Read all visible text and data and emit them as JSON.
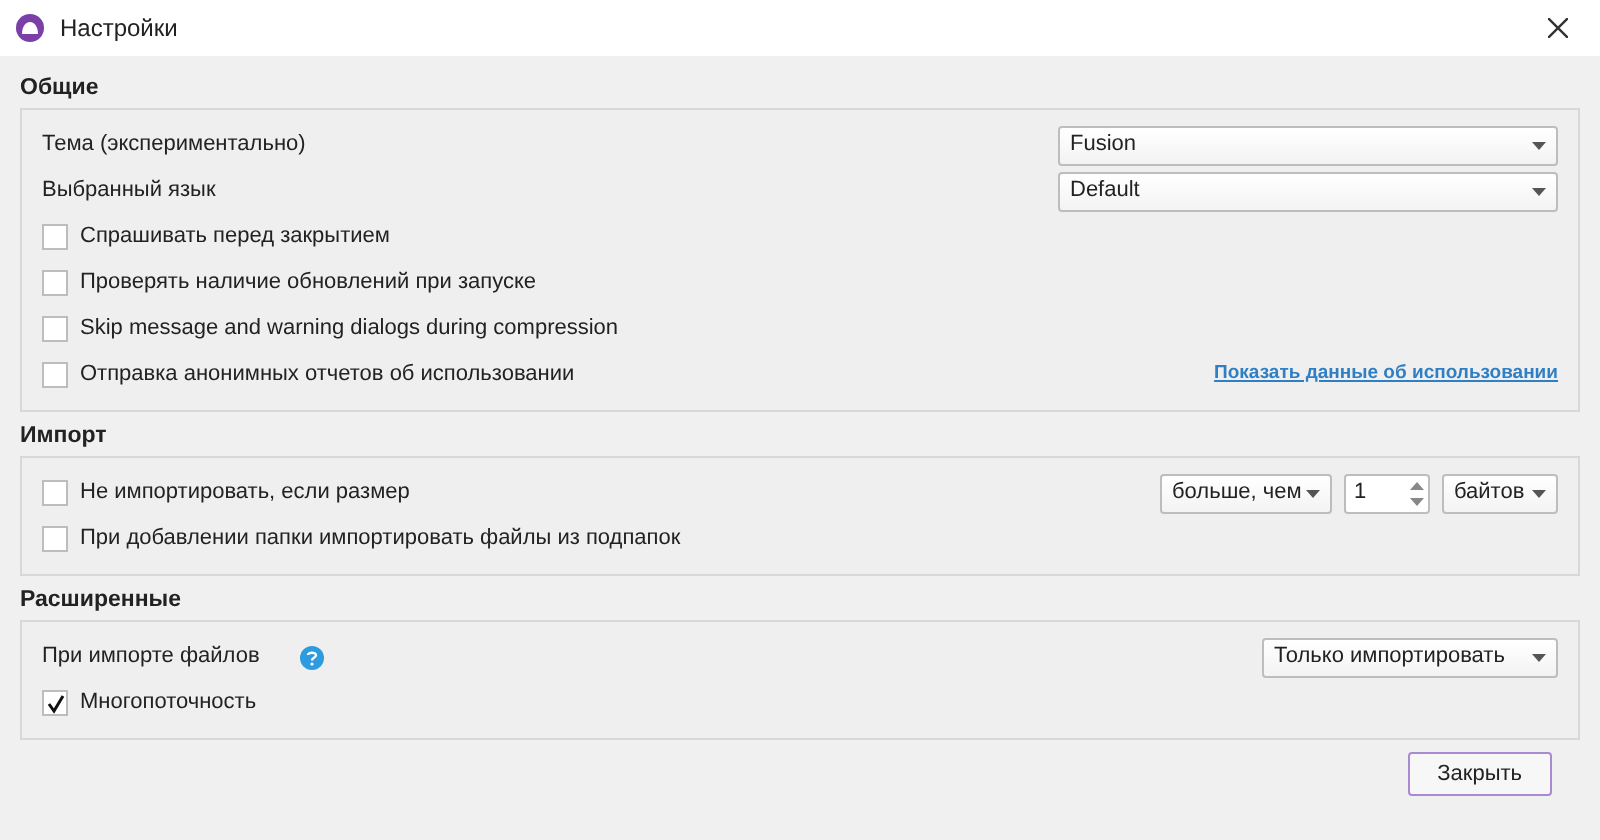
{
  "window": {
    "title": "Настройки"
  },
  "sections": [
    {
      "title": "Общие",
      "rows": [
        {
          "kind": "select",
          "label": "Тема (экспериментально)",
          "value": "Fusion"
        },
        {
          "kind": "select",
          "label": "Выбранный язык",
          "value": "Default"
        },
        {
          "kind": "checkbox",
          "label": "Спрашивать перед закрытием",
          "checked": false
        },
        {
          "kind": "checkbox",
          "label": "Проверять наличие обновлений при запуске",
          "checked": false
        },
        {
          "kind": "checkbox",
          "label": "Skip message and warning dialogs during compression",
          "checked": false
        },
        {
          "kind": "checkbox",
          "label": "Отправка анонимных отчетов об использовании",
          "checked": false,
          "link": "Показать данные об использовании"
        }
      ]
    },
    {
      "title": "Импорт",
      "rows": [
        {
          "kind": "size_filter",
          "label": "Не импортировать, если размер",
          "checked": false,
          "comparator": "больше, чем",
          "number": "1",
          "unit": "байтов"
        },
        {
          "kind": "checkbox",
          "label": "При добавлении папки импортировать файлы из подпапок",
          "checked": false
        }
      ]
    },
    {
      "title": "Расширенные",
      "rows": [
        {
          "kind": "select_help",
          "label": "При импорте файлов",
          "value": "Только импортировать"
        },
        {
          "kind": "checkbox",
          "label": "Многопоточность",
          "checked": true
        }
      ]
    }
  ],
  "buttons": [
    {
      "label": "Закрыть"
    }
  ]
}
